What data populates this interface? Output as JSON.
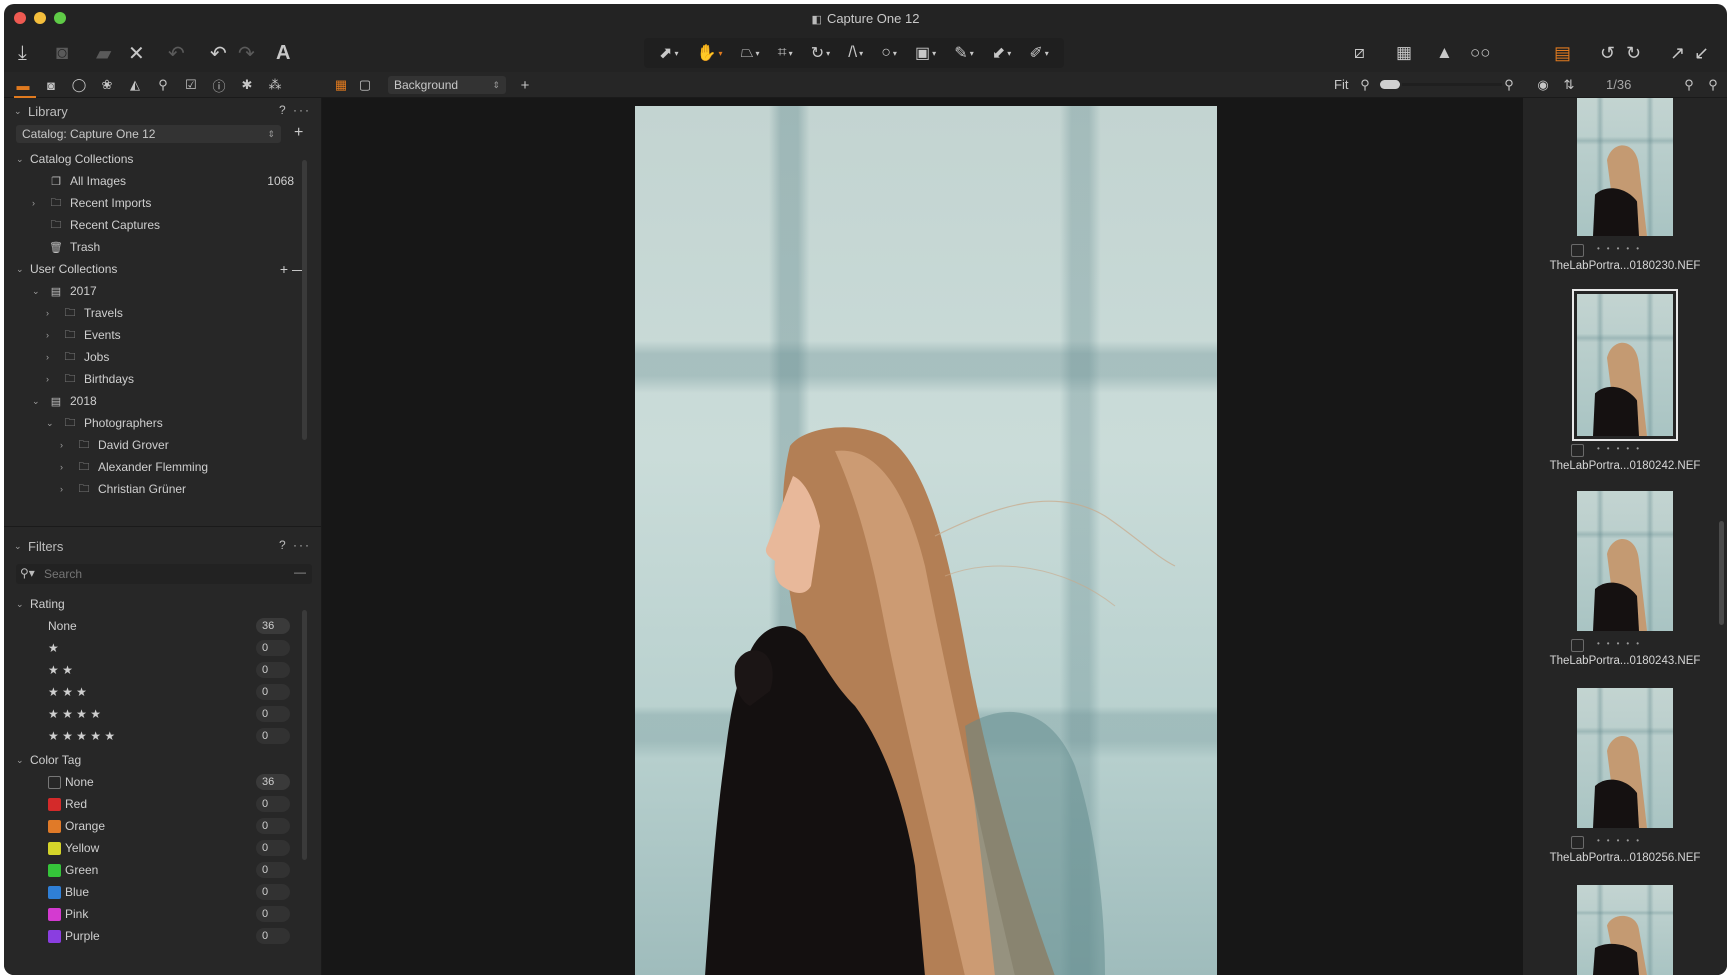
{
  "window": {
    "title": "Capture One 12"
  },
  "toolbar": {
    "left_icons": [
      "import-icon",
      "camera-icon",
      "export-icon",
      "delete-icon",
      "undo-history-icon",
      "undo-icon",
      "redo-icon",
      "text-icon"
    ],
    "tools": [
      {
        "name": "select-tool",
        "glyph": "⬈"
      },
      {
        "name": "pan-tool",
        "glyph": "✋",
        "active": true
      },
      {
        "name": "keystone-tool",
        "glyph": "⏢"
      },
      {
        "name": "crop-tool",
        "glyph": "⌗"
      },
      {
        "name": "rotate-tool",
        "glyph": "↻"
      },
      {
        "name": "straighten-tool",
        "glyph": "/\\"
      },
      {
        "name": "spot-removal-tool",
        "glyph": "○"
      },
      {
        "name": "mask-tool",
        "glyph": "▣"
      },
      {
        "name": "brush-tool",
        "glyph": "✎"
      },
      {
        "name": "gradient-tool",
        "glyph": "⬋"
      },
      {
        "name": "eraser-tool",
        "glyph": "✐"
      }
    ],
    "right_icons": [
      "before-after-icon",
      "grid-icon",
      "exposure-warning-icon",
      "proof-icon",
      "variants-icon",
      "rotate-left-icon",
      "rotate-right-icon",
      "expand-icon",
      "collapse-icon"
    ]
  },
  "tool_tabs": [
    "library-tab",
    "capture-tab",
    "lens-tab",
    "color-tab",
    "exposure-tab",
    "details-tab",
    "adjustments-tab",
    "metadata-tab",
    "output-tab",
    "batch-tab"
  ],
  "viewer_bar": {
    "layer_select": "Background",
    "zoom_label": "Fit",
    "image_counter": "1/36"
  },
  "library": {
    "title": "Library",
    "help": "?",
    "more": "···",
    "catalog_select": "Catalog: Capture One 12",
    "catalog_collections": {
      "label": "Catalog Collections",
      "items": [
        {
          "label": "All Images",
          "count": "1068",
          "icon": "all-images-icon",
          "expandable": false
        },
        {
          "label": "Recent Imports",
          "count": "",
          "icon": "folder-icon",
          "expandable": true
        },
        {
          "label": "Recent Captures",
          "count": "",
          "icon": "folder-icon",
          "expandable": false
        },
        {
          "label": "Trash",
          "count": "",
          "icon": "trash-icon",
          "expandable": false
        }
      ]
    },
    "user_collections": {
      "label": "User Collections",
      "items": [
        {
          "label": "2017",
          "level": 1,
          "icon": "project-icon",
          "state": "open"
        },
        {
          "label": "Travels",
          "level": 2,
          "icon": "folder-icon",
          "state": "closed"
        },
        {
          "label": "Events",
          "level": 2,
          "icon": "folder-icon",
          "state": "closed"
        },
        {
          "label": "Jobs",
          "level": 2,
          "icon": "folder-icon",
          "state": "closed"
        },
        {
          "label": "Birthdays",
          "level": 2,
          "icon": "folder-icon",
          "state": "closed"
        },
        {
          "label": "2018",
          "level": 1,
          "icon": "project-icon",
          "state": "open"
        },
        {
          "label": "Photographers",
          "level": 2,
          "icon": "folder-icon",
          "state": "open"
        },
        {
          "label": "David Grover",
          "level": 3,
          "icon": "folder-icon",
          "state": "closed"
        },
        {
          "label": "Alexander Flemming",
          "level": 3,
          "icon": "folder-icon",
          "state": "closed"
        },
        {
          "label": "Christian Grüner",
          "level": 3,
          "icon": "folder-icon",
          "state": "closed"
        }
      ]
    }
  },
  "filters": {
    "title": "Filters",
    "help": "?",
    "more": "···",
    "search_placeholder": "Search",
    "rating": {
      "label": "Rating",
      "items": [
        {
          "label": "None",
          "count": "36"
        },
        {
          "label": "★",
          "count": "0"
        },
        {
          "label": "★ ★",
          "count": "0"
        },
        {
          "label": "★ ★ ★",
          "count": "0"
        },
        {
          "label": "★ ★ ★ ★",
          "count": "0"
        },
        {
          "label": "★ ★ ★ ★ ★",
          "count": "0"
        }
      ]
    },
    "color_tag": {
      "label": "Color Tag",
      "items": [
        {
          "label": "None",
          "count": "36",
          "color": ""
        },
        {
          "label": "Red",
          "count": "0",
          "color": "#d42a2a"
        },
        {
          "label": "Orange",
          "count": "0",
          "color": "#e07a28"
        },
        {
          "label": "Yellow",
          "count": "0",
          "color": "#d4d42a"
        },
        {
          "label": "Green",
          "count": "0",
          "color": "#35c43a"
        },
        {
          "label": "Blue",
          "count": "0",
          "color": "#2f7fd6"
        },
        {
          "label": "Pink",
          "count": "0",
          "color": "#d43ad0"
        },
        {
          "label": "Purple",
          "count": "0",
          "color": "#8a3ee0"
        }
      ]
    }
  },
  "browser": {
    "thumbnails": [
      {
        "name": "TheLabPortra...0180230.NEF",
        "selected": false
      },
      {
        "name": "TheLabPortra...0180242.NEF",
        "selected": true
      },
      {
        "name": "TheLabPortra...0180243.NEF",
        "selected": false
      },
      {
        "name": "TheLabPortra...0180256.NEF",
        "selected": false
      },
      {
        "name": "",
        "selected": false
      }
    ]
  },
  "colors": {
    "accent": "#e07a1f"
  }
}
